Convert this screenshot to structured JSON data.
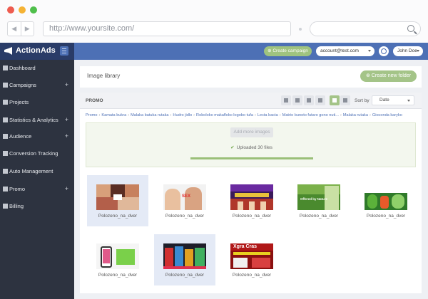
{
  "browser": {
    "url": "http://www.yoursite.com/",
    "back_icon": "back-arrow-icon",
    "forward_icon": "forward-arrow-icon",
    "search_icon": "search-icon"
  },
  "app": {
    "brand": "ActionAds",
    "brand_color": "#2a3c68",
    "topbar_color": "#4d70b5",
    "accent_green": "#a4c488",
    "create_campaign": "⊕ Create campaign",
    "account": "account@test.com",
    "user": "John Doe"
  },
  "sidebar": {
    "items": [
      {
        "label": "Dashboard",
        "icon": "home-icon",
        "expandable": false
      },
      {
        "label": "Campaigns",
        "icon": "megaphone-icon",
        "expandable": true
      },
      {
        "label": "Projects",
        "icon": "briefcase-icon",
        "expandable": false
      },
      {
        "label": "Statistics & Analytics",
        "icon": "chart-icon",
        "expandable": true
      },
      {
        "label": "Audience",
        "icon": "users-icon",
        "expandable": true
      },
      {
        "label": "Conversion Tracking",
        "icon": "target-icon",
        "expandable": false
      },
      {
        "label": "Auto Management",
        "icon": "rocket-icon",
        "expandable": false
      },
      {
        "label": "Promo",
        "icon": "image-icon",
        "expandable": true
      },
      {
        "label": "Billing",
        "icon": "wallet-icon",
        "expandable": false
      }
    ],
    "expand_symbol": "+"
  },
  "library": {
    "title": "Image library",
    "new_folder": "⊕ Create new folder"
  },
  "folder": {
    "title": "PROMO",
    "tools": [
      "download-icon",
      "copy-icon",
      "cut-icon",
      "trash-icon"
    ],
    "sort_label": "Sort by",
    "sort_value": "Date",
    "breadcrumb": [
      "Promo",
      "Kamata bukra",
      "Malaka batuka rutaka",
      "Hudro jidlo",
      "Roboloko makafloko logobo tufa",
      "Lecta bacta",
      "Matrio bunoto futaro gono nuti...",
      "Malaka rutaka",
      "Gioconda karyko"
    ],
    "breadcrumb_sep": "›"
  },
  "upload": {
    "button": "Add more images",
    "status": "Uploaded 30 files",
    "progress": 1.0
  },
  "files": [
    {
      "name": "Polozeno_na_dver",
      "selected": true,
      "thumb": "people-collage"
    },
    {
      "name": "Polozeno_na_dver",
      "selected": false,
      "thumb": "couple-sex-ad"
    },
    {
      "name": "Polozeno_na_dver",
      "selected": false,
      "thumb": "celebration-banner"
    },
    {
      "name": "Polozeno_na_dver",
      "selected": false,
      "thumb": "offered-by-nature-ad"
    },
    {
      "name": "Polozeno_na_dver",
      "selected": false,
      "thumb": "green-products-ad"
    },
    {
      "name": "Polozeno_na_dver",
      "selected": false,
      "thumb": "phone-app-ad"
    },
    {
      "name": "Polozeno_na_dver",
      "selected": true,
      "thumb": "gadgets-ad"
    },
    {
      "name": "Polozeno_na_dver",
      "selected": false,
      "thumb": "xgra-red-ad"
    }
  ],
  "thumb_texts": {
    "couple-sex-ad": "SEX",
    "offered-by-nature-ad": "Offered by Nature",
    "xgra-red-ad": "Xgra Cras"
  }
}
